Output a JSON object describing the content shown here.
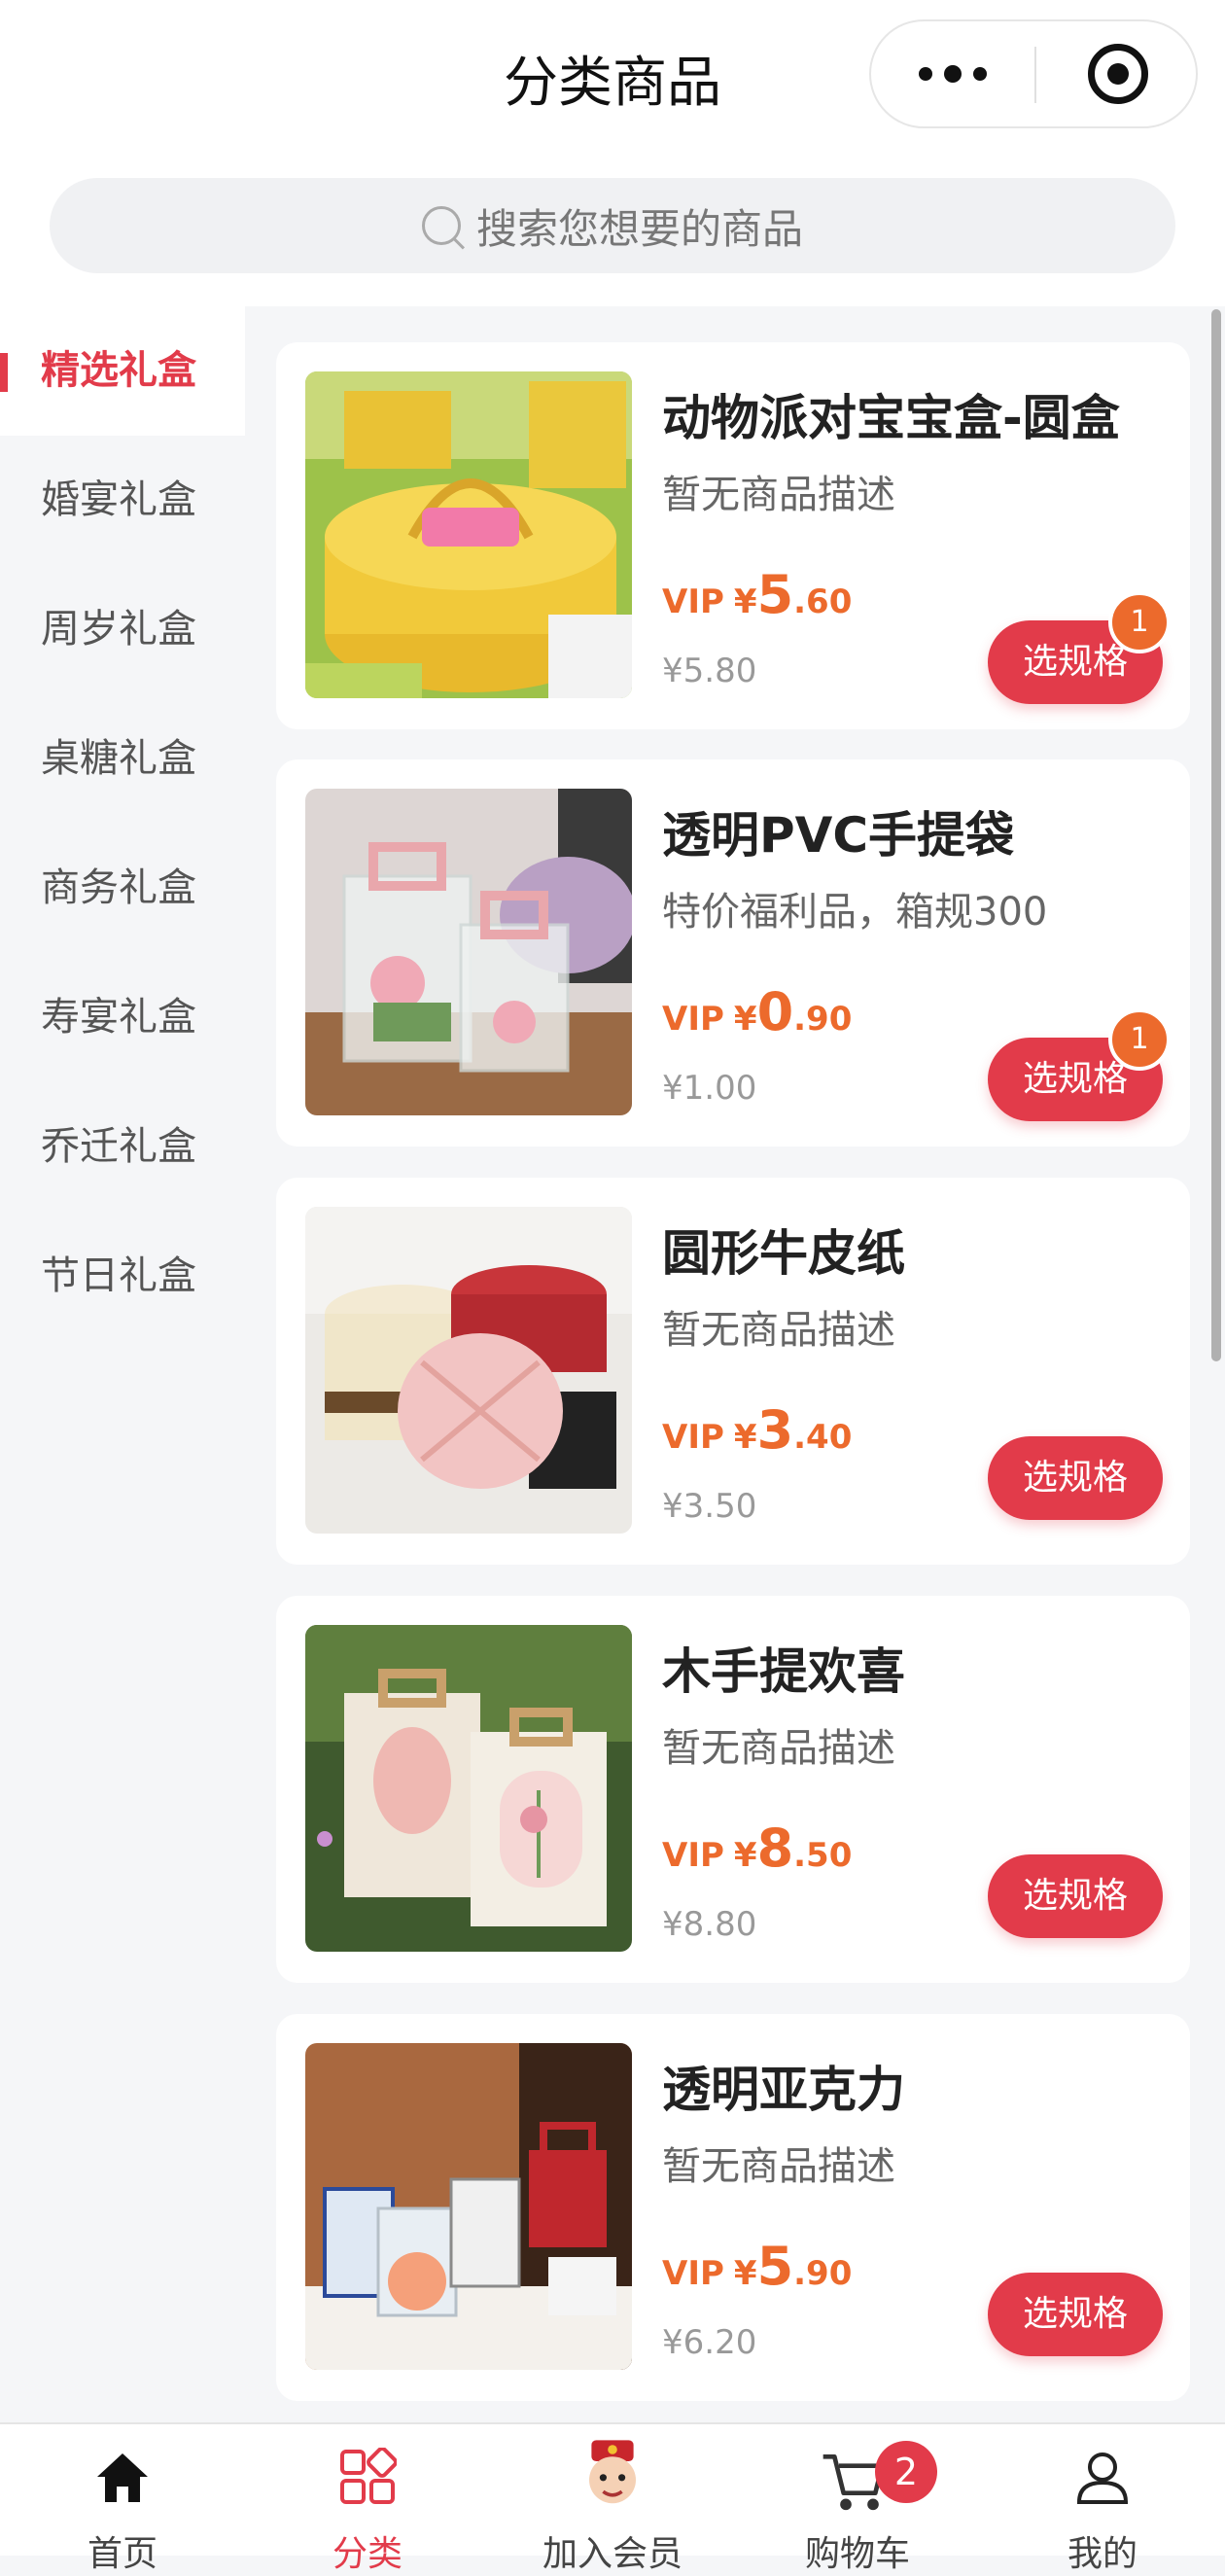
{
  "header": {
    "title": "分类商品",
    "search_placeholder": "搜索您想要的商品"
  },
  "categories": [
    {
      "label": "精选礼盒",
      "active": true
    },
    {
      "label": "婚宴礼盒",
      "active": false
    },
    {
      "label": "周岁礼盒",
      "active": false
    },
    {
      "label": "桌糖礼盒",
      "active": false
    },
    {
      "label": "商务礼盒",
      "active": false
    },
    {
      "label": "寿宴礼盒",
      "active": false
    },
    {
      "label": "乔迁礼盒",
      "active": false
    },
    {
      "label": "节日礼盒",
      "active": false
    }
  ],
  "products": [
    {
      "name": "动物派对宝宝盒-圆盒",
      "desc": "暂无商品描述",
      "vip_tag": "VIP",
      "currency": "¥",
      "vip_int": "5",
      "vip_dec": ".60",
      "orig": "¥5.80",
      "button": "选规格",
      "badge": "1"
    },
    {
      "name": "透明PVC手提袋",
      "desc": "特价福利品，箱规300",
      "vip_tag": "VIP",
      "currency": "¥",
      "vip_int": "0",
      "vip_dec": ".90",
      "orig": "¥1.00",
      "button": "选规格",
      "badge": "1"
    },
    {
      "name": "圆形牛皮纸",
      "desc": "暂无商品描述",
      "vip_tag": "VIP",
      "currency": "¥",
      "vip_int": "3",
      "vip_dec": ".40",
      "orig": "¥3.50",
      "button": "选规格"
    },
    {
      "name": "木手提欢喜",
      "desc": "暂无商品描述",
      "vip_tag": "VIP",
      "currency": "¥",
      "vip_int": "8",
      "vip_dec": ".50",
      "orig": "¥8.80",
      "button": "选规格"
    },
    {
      "name": "透明亚克力",
      "desc": "暂无商品描述",
      "vip_tag": "VIP",
      "currency": "¥",
      "vip_int": "5",
      "vip_dec": ".90",
      "orig": "¥6.20",
      "button": "选规格"
    }
  ],
  "tabbar": {
    "tabs": [
      {
        "label": "首页",
        "icon": "home-icon"
      },
      {
        "label": "分类",
        "icon": "category-icon",
        "active": true
      },
      {
        "label": "加入会员",
        "icon": "mascot-icon"
      },
      {
        "label": "购物车",
        "icon": "cart-icon",
        "badge": "2"
      },
      {
        "label": "我的",
        "icon": "user-icon"
      }
    ]
  },
  "colors": {
    "accent": "#e23b4a",
    "vip_price": "#ec6a2c",
    "background": "#f5f6f8"
  }
}
